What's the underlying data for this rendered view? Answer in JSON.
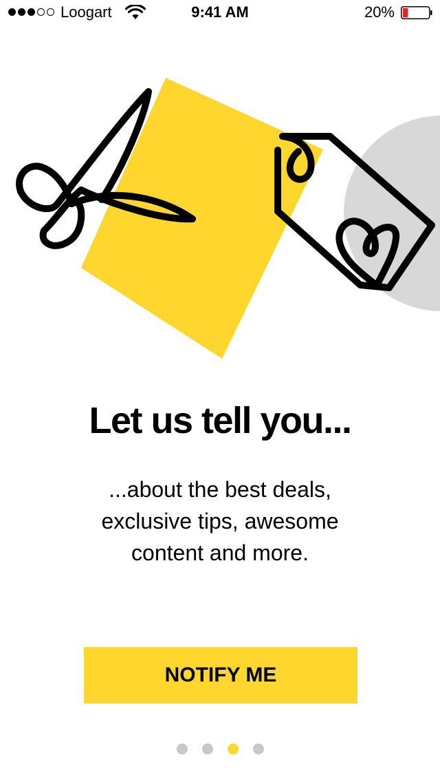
{
  "status_bar": {
    "signal_bars_filled": 3,
    "signal_bars_total": 5,
    "carrier": "Loogart",
    "wifi_icon": "wifi-icon",
    "time": "9:41 AM",
    "battery_percent": "20%",
    "battery_level": 0.2,
    "battery_color": "#E0251F"
  },
  "onboarding": {
    "illustration_icons": [
      "scissors-icon",
      "price-tag-heart-icon"
    ],
    "headline": "Let us tell you...",
    "subtext": "...about the best deals,\nexclusive tips, awesome\ncontent and more.",
    "cta_label": "NOTIFY ME"
  },
  "pager": {
    "count": 4,
    "active_index": 2
  },
  "colors": {
    "accent": "#FFD62E",
    "inactive_dot": "#C8C8C8",
    "circle": "#D8D8D8",
    "text": "#000000"
  }
}
